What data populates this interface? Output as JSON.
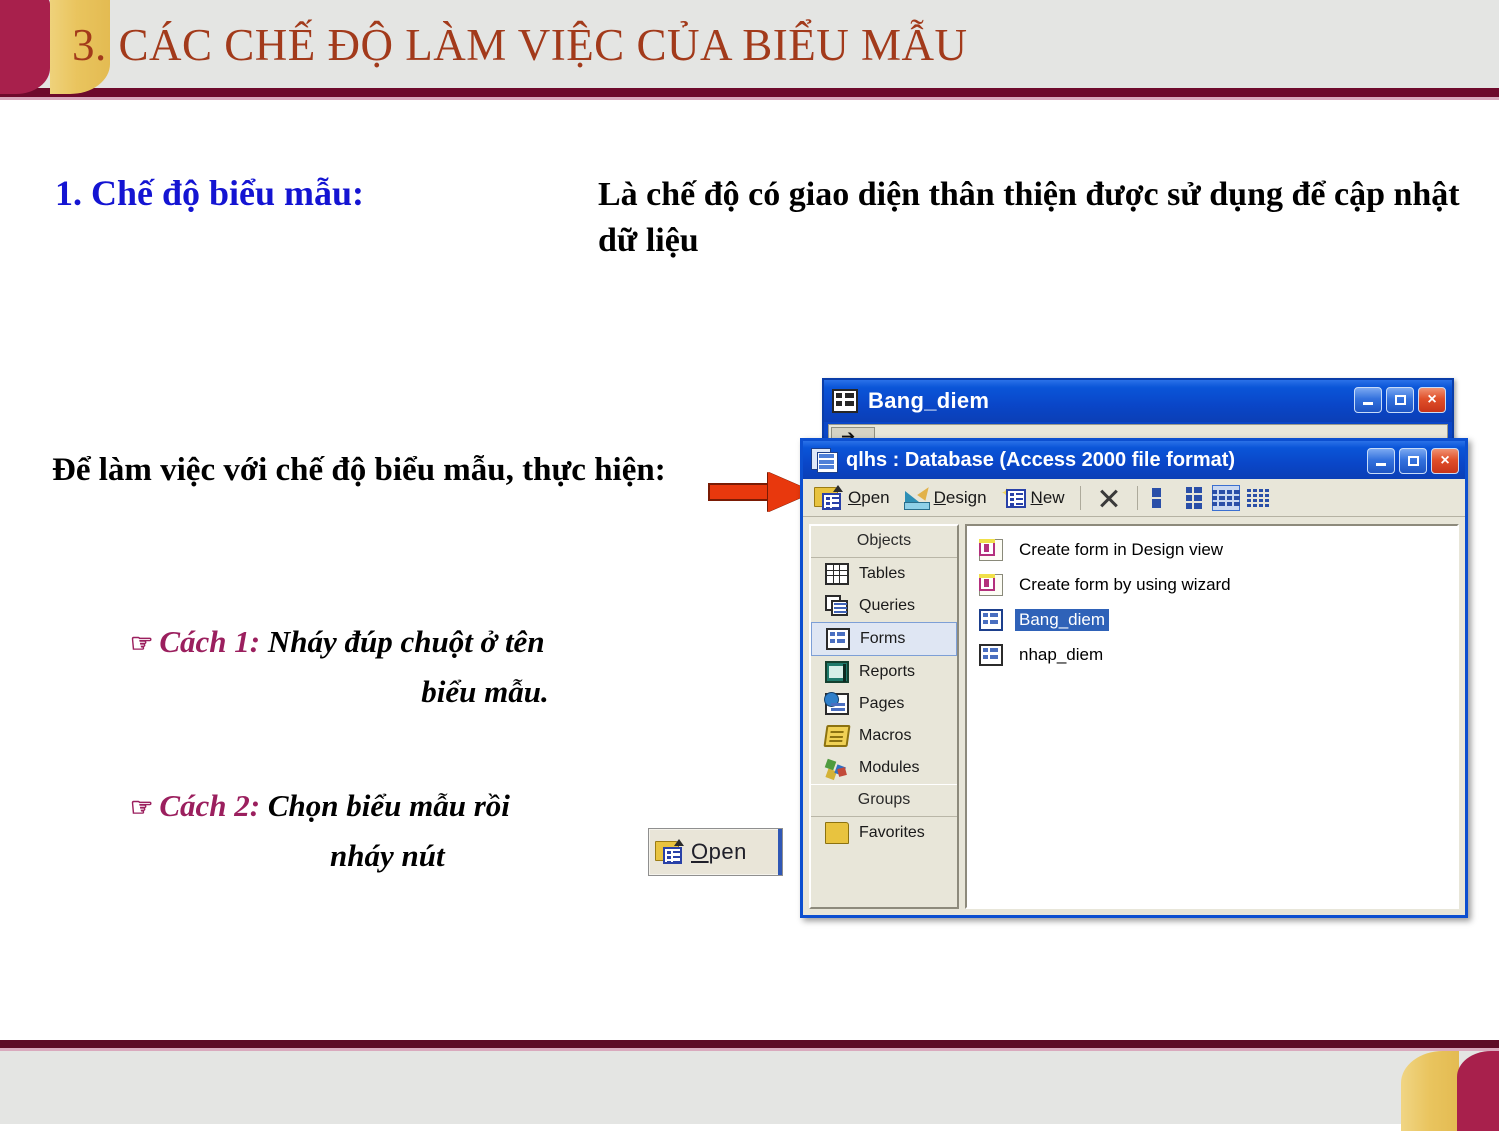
{
  "slide": {
    "title": "3. CÁC CHẾ ĐỘ LÀM VIỆC CỦA BIỂU MẪU",
    "title_color": "#a23a1b",
    "accent_maroon": "#a8204c",
    "accent_gold": "#e9c45e",
    "heading_color": "#1414d2",
    "cach_label_color": "#9b1f5e",
    "arrow_color": "#e8380d"
  },
  "content": {
    "heading_1": "1. Chế độ biểu mẫu:",
    "definition": "Là chế độ có giao diện thân thiện được sử dụng để cập nhật dữ liệu",
    "instruction": "Để làm việc với chế độ biểu mẫu, thực hiện:",
    "cach1": {
      "hand_icon": "hand-pointer-icon",
      "label": "Cách 1",
      "separator": ":",
      "text_line1": "Nháy đúp chuột ở tên",
      "text_line2": "biểu mẫu."
    },
    "cach2": {
      "hand_icon": "hand-pointer-icon",
      "label": "Cách 2",
      "separator": ":",
      "text_line1": "Chọn biểu mẫu rồi",
      "text_line2": "nháy nút"
    },
    "open_button_graphic": {
      "icon": "folder-open-form-icon",
      "accel_letter": "O",
      "rest_label": "pen"
    }
  },
  "access": {
    "bangdiem_window": {
      "icon": "form-icon",
      "title": "Bang_diem",
      "controls": {
        "minimize": "minimize-icon",
        "maximize": "maximize-icon",
        "close": "×"
      }
    },
    "qlhs_window": {
      "icon": "database-icon",
      "title": "qlhs : Database (Access 2000 file format)",
      "controls": {
        "minimize": "minimize-icon",
        "maximize": "maximize-icon",
        "close": "×"
      },
      "toolbar": [
        {
          "name": "open",
          "icon": "folder-open-form-icon",
          "accel": "O",
          "rest": "pen"
        },
        {
          "name": "design",
          "icon": "design-ruler-pencil-icon",
          "accel": "D",
          "rest": "esign"
        },
        {
          "name": "new",
          "icon": "new-form-sparkle-icon",
          "accel": "N",
          "rest": "ew"
        },
        {
          "name": "delete",
          "icon": "delete-x-icon",
          "accel": "",
          "rest": ""
        }
      ],
      "view_buttons": [
        {
          "name": "large-icons-view",
          "active": false
        },
        {
          "name": "small-icons-view",
          "active": false
        },
        {
          "name": "list-view",
          "active": true
        },
        {
          "name": "details-view",
          "active": false
        }
      ],
      "objects_panel": {
        "header": "Objects",
        "items": [
          {
            "label": "Tables",
            "icon": "tables-icon",
            "selected": false
          },
          {
            "label": "Queries",
            "icon": "queries-icon",
            "selected": false
          },
          {
            "label": "Forms",
            "icon": "forms-icon",
            "selected": true
          },
          {
            "label": "Reports",
            "icon": "reports-icon",
            "selected": false
          },
          {
            "label": "Pages",
            "icon": "pages-icon",
            "selected": false
          },
          {
            "label": "Macros",
            "icon": "macros-icon",
            "selected": false
          },
          {
            "label": "Modules",
            "icon": "modules-icon",
            "selected": false
          }
        ],
        "groups_header": "Groups",
        "groups": [
          {
            "label": "Favorites",
            "icon": "favorites-folder-icon",
            "selected": false
          }
        ]
      },
      "forms_list": [
        {
          "label": "Create form in Design view",
          "icon": "new-form-shortcut-icon",
          "selected": false
        },
        {
          "label": "Create form by using wizard",
          "icon": "new-form-shortcut-icon",
          "selected": false
        },
        {
          "label": "Bang_diem",
          "icon": "form-item-icon",
          "selected": true
        },
        {
          "label": "nhap_diem",
          "icon": "form-item-icon",
          "selected": false
        }
      ]
    },
    "annotations": [
      {
        "name": "arrow-to-database-window",
        "direction": "right"
      },
      {
        "name": "arrow-to-bang-diem-item",
        "direction": "left"
      }
    ]
  }
}
